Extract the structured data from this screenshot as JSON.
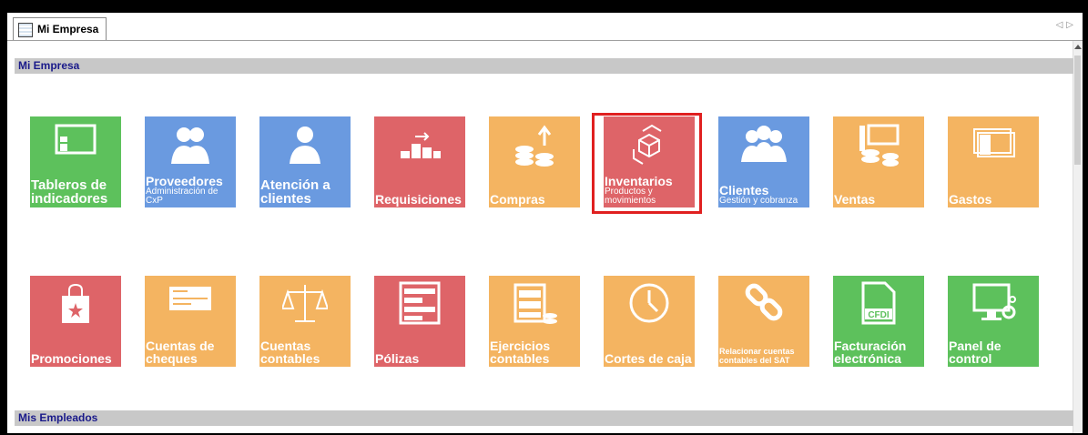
{
  "window": {
    "tab_title": "Mi Empresa"
  },
  "sections": {
    "empresa": "Mi Empresa",
    "empleados": "Mis Empleados"
  },
  "colors": {
    "green": "#5dc15c",
    "blue": "#6a9ae0",
    "red": "#de6468",
    "orange": "#f4b461",
    "selection": "#e02020"
  },
  "row1": [
    {
      "title": "Tableros de indicadores",
      "icon": "dashboard-icon",
      "color": "green"
    },
    {
      "title": "Proveedores",
      "subtitle": "Administración de CxP",
      "icon": "suppliers-icon",
      "color": "blue"
    },
    {
      "title": "Atención a clientes",
      "icon": "customer-service-icon",
      "color": "blue"
    },
    {
      "title": "Requisiciones",
      "icon": "requisitions-icon",
      "color": "red"
    },
    {
      "title": "Compras",
      "icon": "purchases-icon",
      "color": "orange"
    },
    {
      "title": "Inventarios",
      "subtitle": "Productos y movimientos",
      "icon": "boxes-icon",
      "color": "red",
      "selected": true
    },
    {
      "title": "Clientes",
      "subtitle": "Gestión y cobranza",
      "icon": "clients-icon",
      "color": "blue"
    },
    {
      "title": "Ventas",
      "icon": "sales-icon",
      "color": "orange"
    },
    {
      "title": "Gastos",
      "icon": "expenses-icon",
      "color": "orange"
    }
  ],
  "row2": [
    {
      "title": "Promociones",
      "icon": "shopping-bag-icon",
      "color": "red"
    },
    {
      "title": "Cuentas de cheques",
      "icon": "cheque-icon",
      "color": "orange"
    },
    {
      "title": "Cuentas contables",
      "icon": "balance-scale-icon",
      "color": "orange"
    },
    {
      "title": "Pólizas",
      "icon": "policy-icon",
      "color": "red"
    },
    {
      "title": "Ejercicios contables",
      "icon": "cabinet-icon",
      "color": "orange"
    },
    {
      "title": "Cortes de caja",
      "icon": "clock-icon",
      "color": "orange"
    },
    {
      "title": "Relacionar cuentas contables del SAT",
      "icon": "link-icon",
      "color": "orange"
    },
    {
      "title": "Facturación electrónica",
      "icon": "cfdi-icon",
      "icon_text": "CFDI",
      "color": "green"
    },
    {
      "title": "Panel de control",
      "icon": "control-panel-icon",
      "color": "green"
    }
  ]
}
